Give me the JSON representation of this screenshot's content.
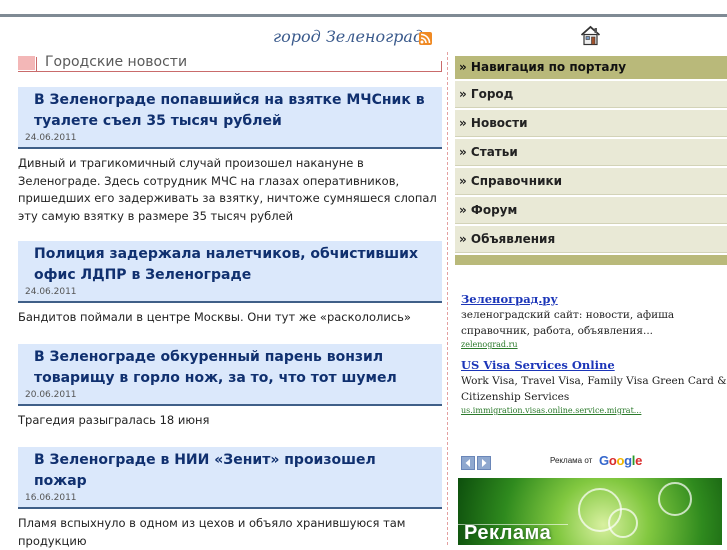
{
  "header": {
    "site_title": "город Зеленоград",
    "rss_icon": "rss-icon",
    "home_icon": "home-icon"
  },
  "news_section": {
    "title": "Городские новости",
    "items": [
      {
        "headline": "В Зеленограде попавшийся на взятке МЧСник в туалете съел 35 тысяч рублей",
        "date": "24.06.2011",
        "summary": "Дивный и трагикомичный случай произошел накануне в Зеленограде. Здесь сотрудник МЧС на глазах оперативников, пришедших его задерживать за взятку, ничтоже сумняшеся слопал эту самую взятку в размере 35 тысяч рублей"
      },
      {
        "headline": "Полиция задержала налетчиков, обчистивших офис ЛДПР в Зеленограде",
        "date": "24.06.2011",
        "summary": "Бандитов поймали в центре Москвы. Они тут же «раскололись»"
      },
      {
        "headline": "В Зеленограде обкуренный парень вонзил товарищу в горло нож, за то, что тот шумел",
        "date": "20.06.2011",
        "summary": "Трагедия разыгралась 18 июня"
      },
      {
        "headline": "В Зеленограде в НИИ «Зенит» произошел пожар",
        "date": "16.06.2011",
        "summary": "Пламя вспыхнуло в одном из цехов и объяло хранившуюся там продукцию"
      }
    ]
  },
  "navigation": {
    "header": "» Навигация по порталу",
    "items": [
      "» Город",
      "» Новости",
      "» Статьи",
      "» Справочники",
      "» Форум",
      "» Объявления"
    ]
  },
  "ads": {
    "items": [
      {
        "title": "Зеленоград.ру",
        "description": "зеленоградский сайт: новости, афиша справочник, работа, объявления...",
        "url": "zelenograd.ru"
      },
      {
        "title": "US Visa Services Online",
        "description": "Work Visa, Travel Visa, Family Visa Green Card & Citizenship Services",
        "url": "us.immigration.visas.online.service.migrat..."
      }
    ],
    "ads_by_label": "Реклама от",
    "google_logo": "Google",
    "banner_text": "Реклама"
  },
  "colors": {
    "headline": "#10306f",
    "news_bg": "#dbe8fb",
    "nav_header_bg": "#b9b97a",
    "nav_item_bg": "#e9e9d6",
    "ad_title": "#1b35b8",
    "ad_url": "#2b7a2b"
  }
}
